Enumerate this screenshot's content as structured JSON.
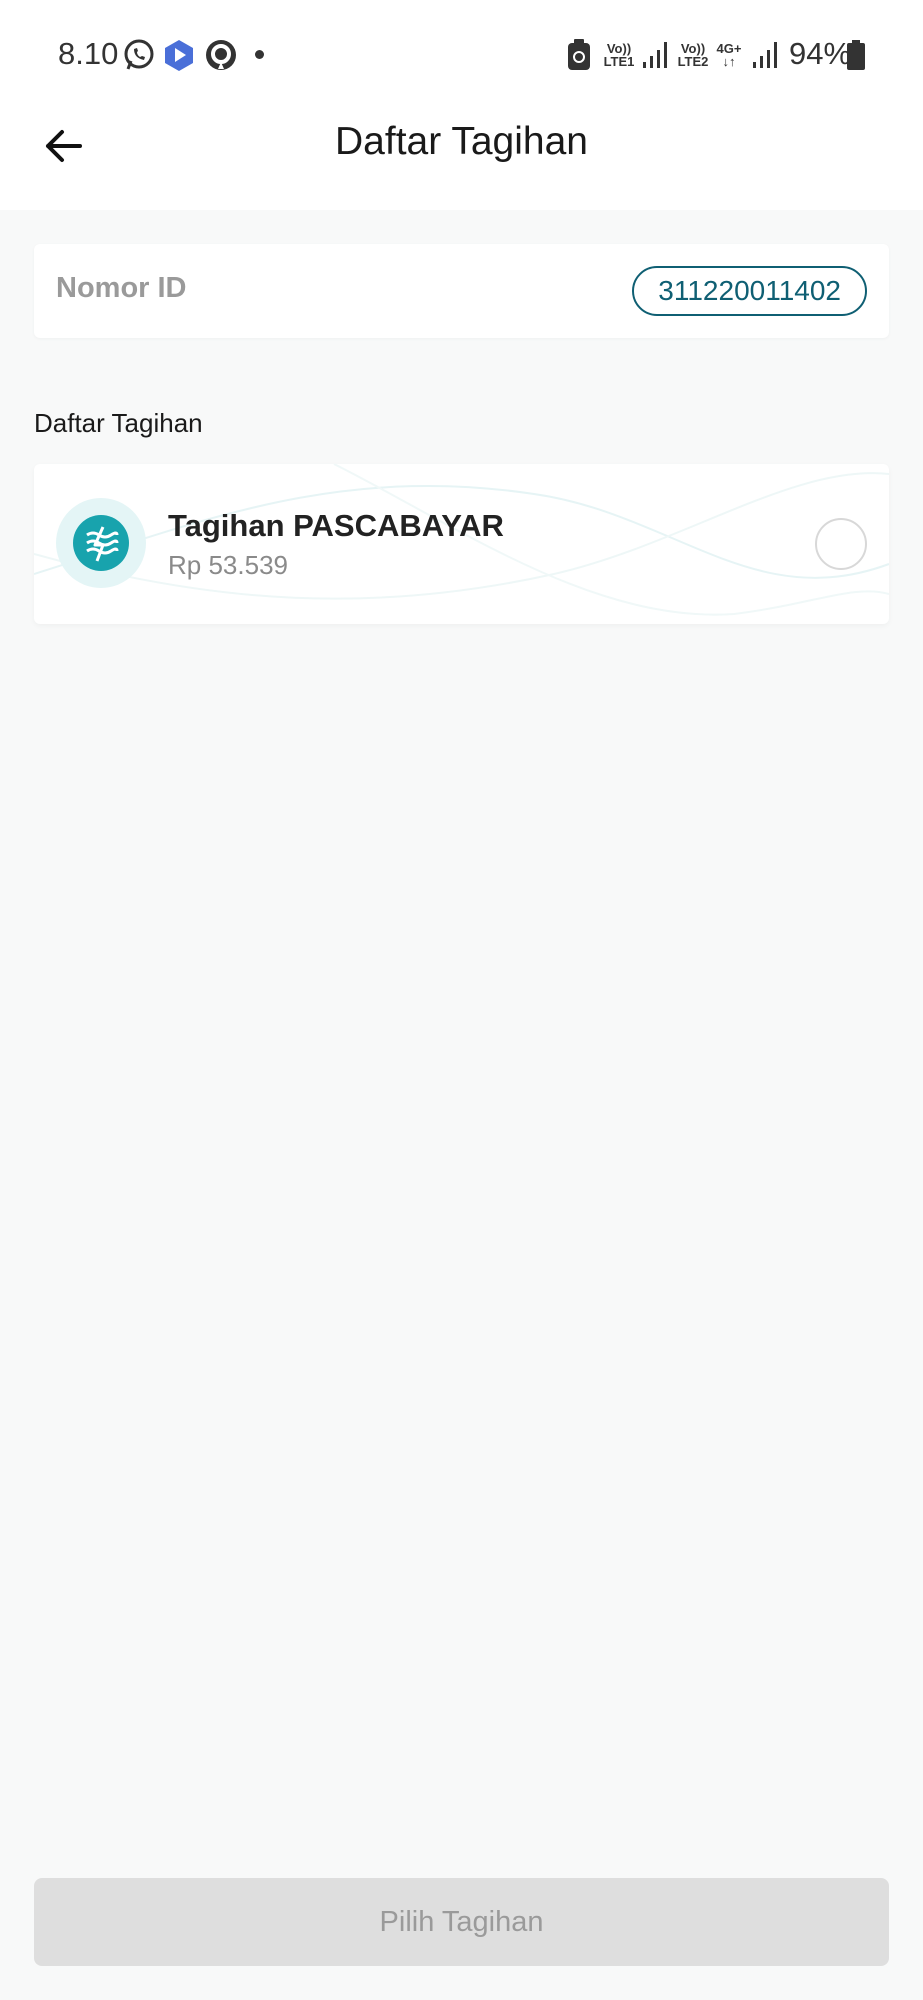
{
  "status_bar": {
    "time": "8.10",
    "sim1_label_top": "Vo))",
    "sim1_label_bottom": "LTE1",
    "sim2_label_top": "Vo))",
    "sim2_label_bottom": "LTE2",
    "network_type": "4G+",
    "network_arrows": "↓↑",
    "battery": "94%"
  },
  "app_bar": {
    "title": "Daftar Tagihan",
    "back_icon": "arrow-left-icon"
  },
  "id_card": {
    "label": "Nomor ID",
    "value": "311220011402"
  },
  "section": {
    "title": "Daftar Tagihan"
  },
  "bills": [
    {
      "name": "Tagihan PASCABAYAR",
      "amount": "Rp 53.539",
      "icon": "pln-logo-icon",
      "selected": false
    }
  ],
  "footer": {
    "button_label": "Pilih Tagihan",
    "enabled": false
  },
  "colors": {
    "accent": "#0f5f73",
    "logo_teal": "#18a3ad",
    "disabled_button": "#dedede"
  }
}
